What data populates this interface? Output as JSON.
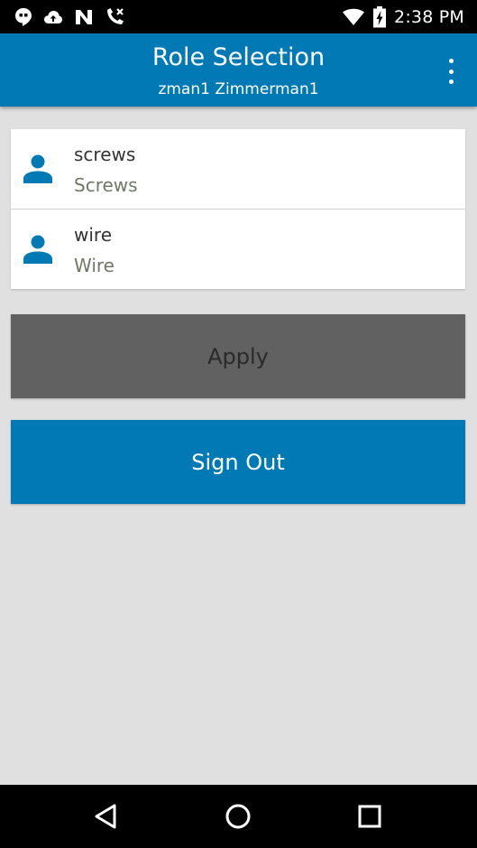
{
  "status_bar": {
    "time": "2:38 PM",
    "icons": [
      "hangouts-icon",
      "cloud-upload-icon",
      "nfc-icon",
      "missed-call-icon",
      "wifi-icon",
      "battery-charging-icon"
    ]
  },
  "app_bar": {
    "title": "Role Selection",
    "subtitle": "zman1 Zimmerman1"
  },
  "roles": [
    {
      "name": "screws",
      "description": "Screws",
      "icon": "person-icon"
    },
    {
      "name": "wire",
      "description": "Wire",
      "icon": "person-icon"
    }
  ],
  "buttons": {
    "apply_label": "Apply",
    "sign_out_label": "Sign Out"
  },
  "navigation": {
    "icons": [
      "back-icon",
      "home-icon",
      "recents-icon"
    ]
  },
  "colors": {
    "primary": "#0079b5",
    "apply_button": "#616161",
    "background": "#e0e0e0"
  }
}
